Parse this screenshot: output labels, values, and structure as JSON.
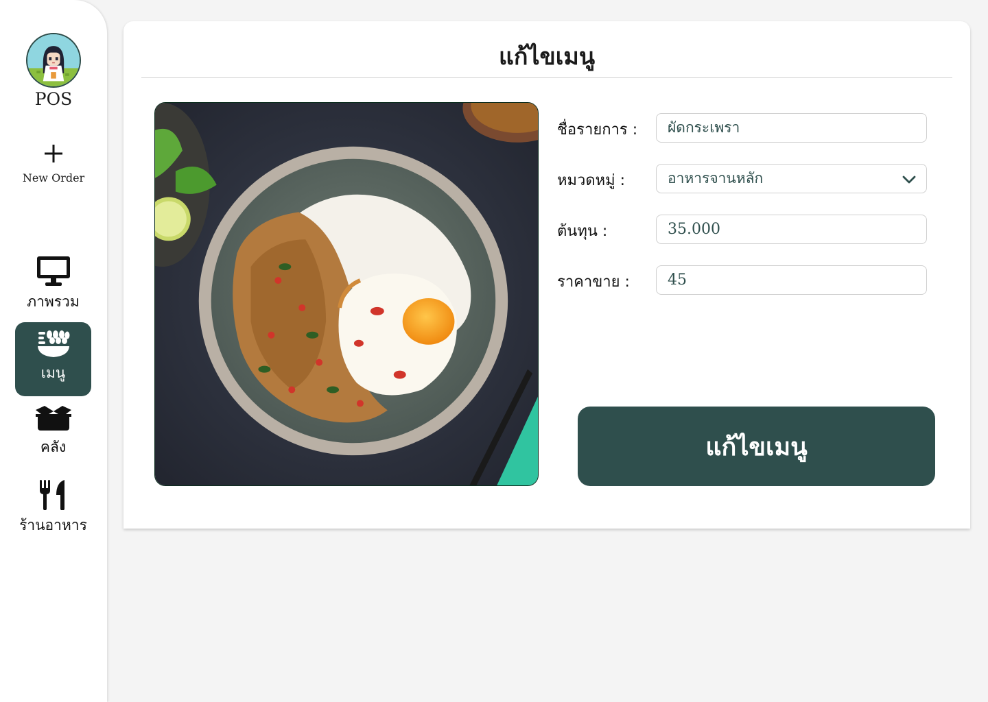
{
  "sidebar": {
    "brand": "POS",
    "new_order": "New Order",
    "items": [
      {
        "label": "ภาพรวม",
        "icon": "monitor-icon",
        "active": false
      },
      {
        "label": "เมนู",
        "icon": "food-bowl-icon",
        "active": true
      },
      {
        "label": "คลัง",
        "icon": "box-icon",
        "active": false
      },
      {
        "label": "ร้านอาหาร",
        "icon": "utensils-icon",
        "active": false
      }
    ]
  },
  "page": {
    "title": "แก้ไขเมนู"
  },
  "form": {
    "name_label": "ชื่อรายการ :",
    "name_value": "ผัดกระเพรา",
    "category_label": "หมวดหมู่ :",
    "category_value": "อาหารจานหลัก",
    "cost_label": "ต้นทุน :",
    "cost_value": "35.000",
    "price_label": "ราคาขาย :",
    "price_value": "45",
    "submit_label": "แก้ไขเมนู"
  },
  "colors": {
    "accent": "#2f4f4d",
    "page_bg": "#f4f4f4",
    "card_bg": "#ffffff"
  }
}
